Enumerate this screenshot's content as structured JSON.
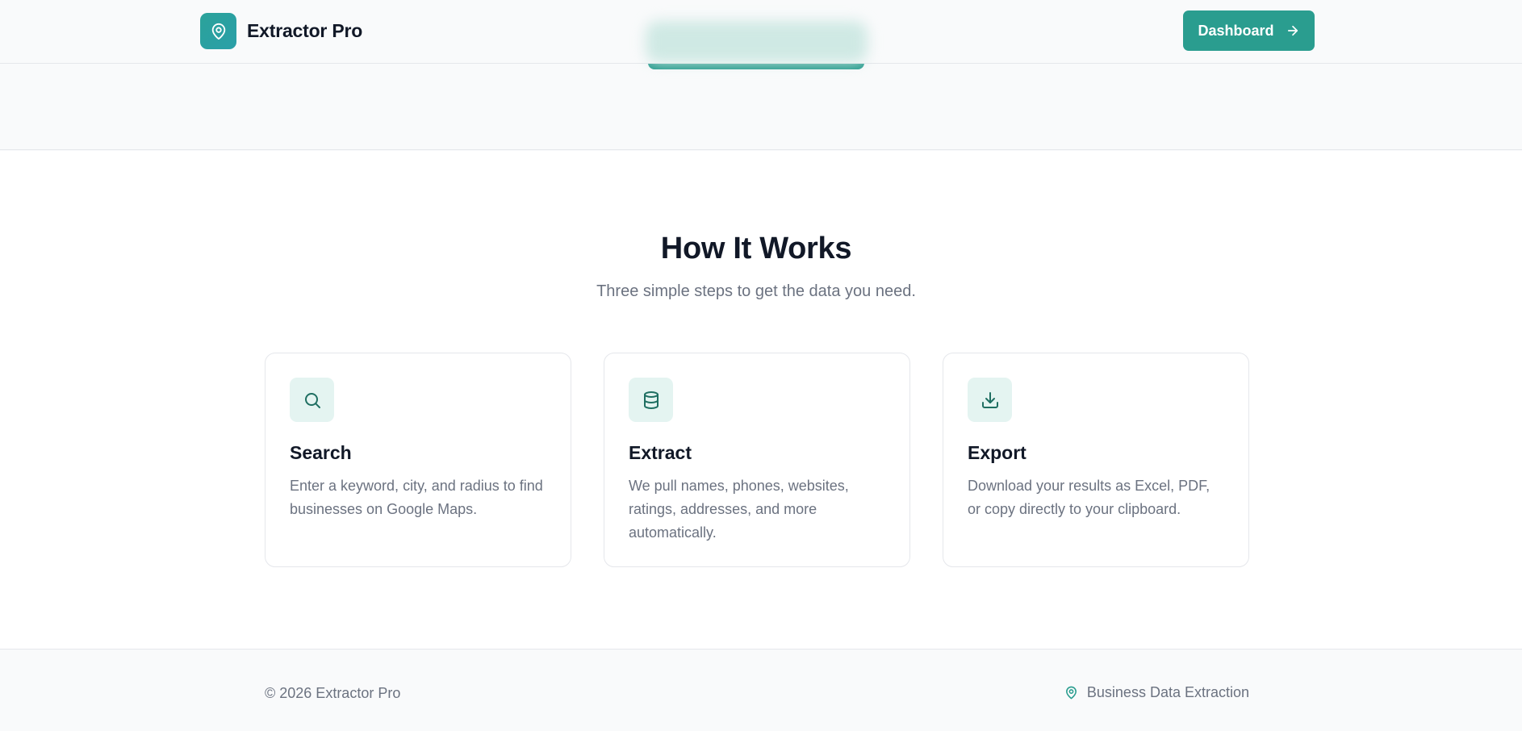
{
  "header": {
    "brand_name": "Extractor Pro",
    "brand_icon": "map-pin-icon",
    "dashboard_label": "Dashboard",
    "dashboard_icon": "arrow-right-icon"
  },
  "how_it_works": {
    "title": "How It Works",
    "subtitle": "Three simple steps to get the data you need.",
    "steps": [
      {
        "icon": "search-icon",
        "title": "Search",
        "description": "Enter a keyword, city, and radius to find businesses on Google Maps."
      },
      {
        "icon": "database-icon",
        "title": "Extract",
        "description": "We pull names, phones, websites, ratings, addresses, and more automatically."
      },
      {
        "icon": "download-icon",
        "title": "Export",
        "description": "Download your results as Excel, PDF, or copy directly to your clipboard."
      }
    ]
  },
  "footer": {
    "copyright": "© 2026 Extractor Pro",
    "tagline": "Business Data Extraction",
    "tagline_icon": "map-pin-icon"
  },
  "colors": {
    "accent": "#2a9d8f",
    "icon_tile": "#e4f4f1",
    "icon_stroke": "#1f6f62",
    "text_primary": "#111827",
    "text_muted": "#6b7280",
    "border": "#e5e7eb",
    "page_bg": "#f9fafb"
  }
}
